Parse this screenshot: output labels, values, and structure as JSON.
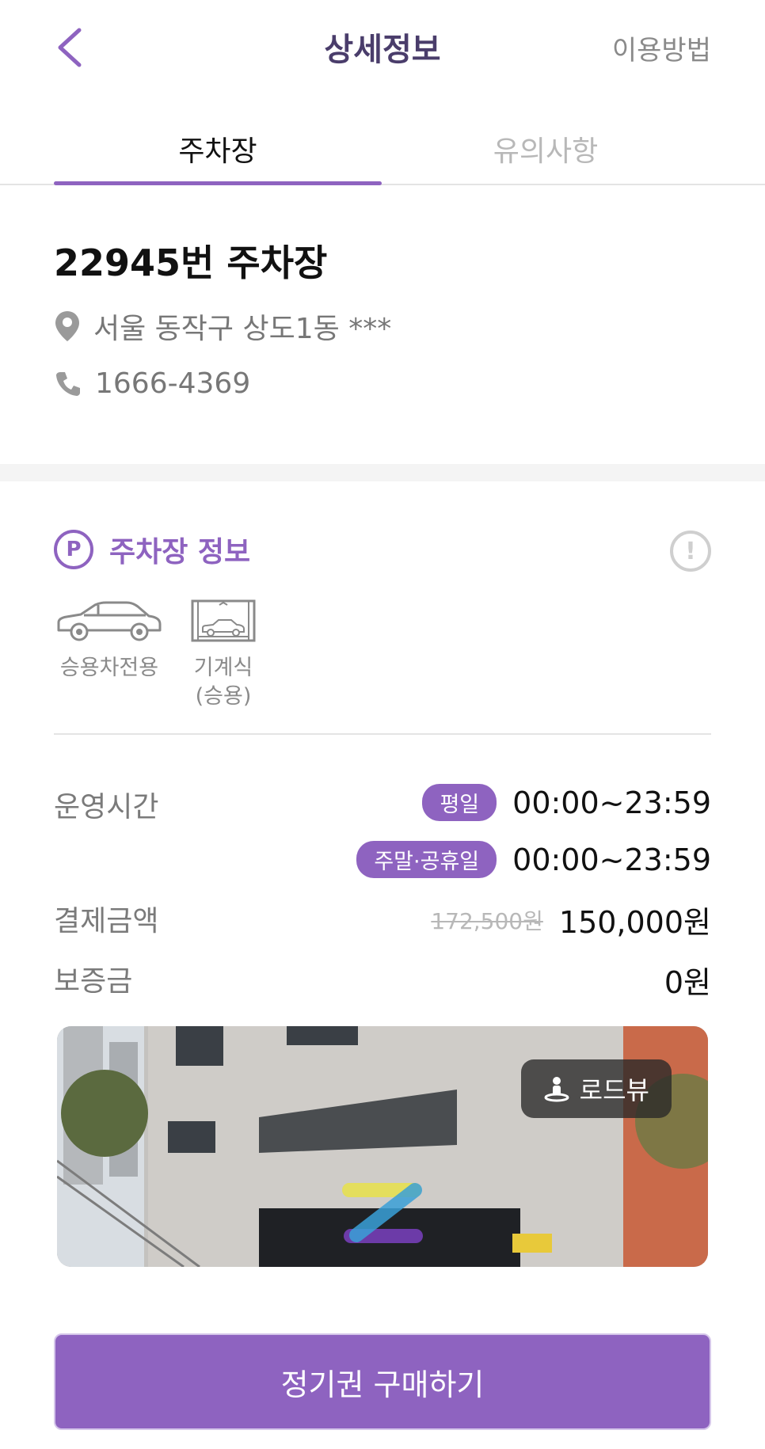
{
  "header": {
    "title": "상세정보",
    "help_label": "이용방법",
    "back_icon": "chevron-left-icon"
  },
  "tabs": [
    {
      "label": "주차장",
      "active": true
    },
    {
      "label": "유의사항",
      "active": false
    }
  ],
  "lot": {
    "name": "22945번 주차장",
    "address": "서울 동작구 상도1동 ***",
    "phone": "1666-4369"
  },
  "info_section": {
    "title": "주차장 정보",
    "badge_letter": "P",
    "alert_symbol": "!",
    "features": [
      {
        "icon": "sedan-car-icon",
        "label": "승용차전용"
      },
      {
        "icon": "mechanical-parking-icon",
        "label_line1": "기계식",
        "label_line2": "(승용)"
      }
    ]
  },
  "details": {
    "hours_label": "운영시간",
    "weekday_tag": "평일",
    "weekday_hours": "00:00~23:59",
    "weekend_tag": "주말·공휴일",
    "weekend_hours": "00:00~23:59",
    "payment_label": "결제금액",
    "original_price": "172,500원",
    "price": "150,000원",
    "deposit_label": "보증금",
    "deposit": "0원"
  },
  "photo": {
    "roadview_label": "로드뷰"
  },
  "cta": {
    "label": "정기권 구매하기"
  },
  "colors": {
    "accent": "#8e63c0",
    "title": "#4a3d6b",
    "muted": "#7a7a7a"
  }
}
